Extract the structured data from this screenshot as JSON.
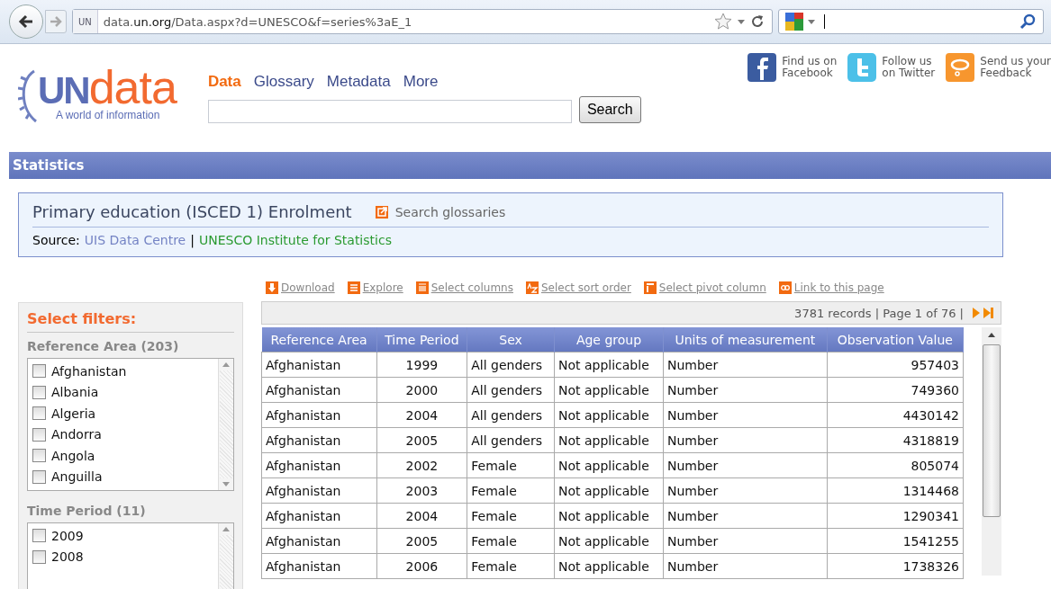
{
  "browser": {
    "address": "data.**un.org**/Data.aspx?d=UNESCO&f=series%3aE_1",
    "site_badge": "UN"
  },
  "header": {
    "logo": {
      "mark": "UN",
      "word": "data",
      "tagline": "A world of information"
    },
    "nav": [
      {
        "label": "Data",
        "selected": true
      },
      {
        "label": "Glossary",
        "selected": false
      },
      {
        "label": "Metadata",
        "selected": false
      },
      {
        "label": "More",
        "selected": false
      }
    ],
    "search_button": "Search",
    "social": [
      {
        "kind": "facebook",
        "lines": [
          "Find us on",
          "Facebook"
        ]
      },
      {
        "kind": "twitter",
        "lines": [
          "Follow us",
          "on Twitter"
        ]
      },
      {
        "kind": "feedback",
        "lines": [
          "Send us your",
          "Feedback"
        ]
      }
    ]
  },
  "section_bar": "Statistics",
  "dataset": {
    "title": "Primary education (ISCED 1) Enrolment",
    "glossary_link": "Search glossaries",
    "source_label": "Source:",
    "source_links": [
      "UIS Data Centre",
      "UNESCO Institute for Statistics"
    ],
    "separator": "|"
  },
  "actions": [
    {
      "kind": "download",
      "label": "Download"
    },
    {
      "kind": "explore",
      "label": "Explore"
    },
    {
      "kind": "columns",
      "label": "Select columns"
    },
    {
      "kind": "sort",
      "label": "Select sort order"
    },
    {
      "kind": "pivot",
      "label": "Select pivot column"
    },
    {
      "kind": "link",
      "label": "Link to this page"
    }
  ],
  "filters": {
    "title": "Select filters:",
    "groups": [
      {
        "title": "Reference Area (203)",
        "items": [
          {
            "label": "Afghanistan",
            "checked": false
          },
          {
            "label": "Albania",
            "checked": false
          },
          {
            "label": "Algeria",
            "checked": false
          },
          {
            "label": "Andorra",
            "checked": false
          },
          {
            "label": "Angola",
            "checked": false
          },
          {
            "label": "Anguilla",
            "checked": false
          }
        ]
      },
      {
        "title": "Time Period (11)",
        "items": [
          {
            "label": "2009",
            "checked": false
          },
          {
            "label": "2008",
            "checked": false
          }
        ]
      }
    ]
  },
  "table": {
    "summary": "3781 records | Page 1 of 76 |",
    "columns": [
      "Reference Area",
      "Time Period",
      "Sex",
      "Age group",
      "Units of measurement",
      "Observation Value"
    ],
    "rows": [
      [
        "Afghanistan",
        "1999",
        "All genders",
        "Not applicable",
        "Number",
        "957403"
      ],
      [
        "Afghanistan",
        "2000",
        "All genders",
        "Not applicable",
        "Number",
        "749360"
      ],
      [
        "Afghanistan",
        "2004",
        "All genders",
        "Not applicable",
        "Number",
        "4430142"
      ],
      [
        "Afghanistan",
        "2005",
        "All genders",
        "Not applicable",
        "Number",
        "4318819"
      ],
      [
        "Afghanistan",
        "2002",
        "Female",
        "Not applicable",
        "Number",
        "805074"
      ],
      [
        "Afghanistan",
        "2003",
        "Female",
        "Not applicable",
        "Number",
        "1314468"
      ],
      [
        "Afghanistan",
        "2004",
        "Female",
        "Not applicable",
        "Number",
        "1290341"
      ],
      [
        "Afghanistan",
        "2005",
        "Female",
        "Not applicable",
        "Number",
        "1541255"
      ],
      [
        "Afghanistan",
        "2006",
        "Female",
        "Not applicable",
        "Number",
        "1738326"
      ]
    ]
  }
}
